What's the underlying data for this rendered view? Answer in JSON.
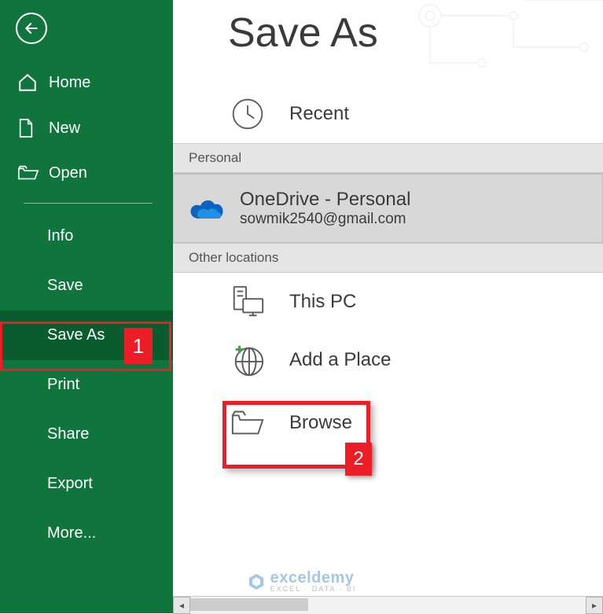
{
  "sidebar": {
    "home_label": "Home",
    "new_label": "New",
    "open_label": "Open",
    "info_label": "Info",
    "save_label": "Save",
    "saveas_label": "Save As",
    "print_label": "Print",
    "share_label": "Share",
    "export_label": "Export",
    "more_label": "More...",
    "badge1": "1"
  },
  "main": {
    "title": "Save As",
    "recent_label": "Recent",
    "personal_header": "Personal",
    "onedrive_title": "OneDrive - Personal",
    "onedrive_sub": "sowmik2540@gmail.com",
    "other_header": "Other locations",
    "thispc_label": "This PC",
    "addplace_label": "Add a Place",
    "browse_label": "Browse",
    "badge2": "2"
  },
  "watermark": {
    "main": "exceldemy",
    "sub": "EXCEL · DATA · BI"
  }
}
